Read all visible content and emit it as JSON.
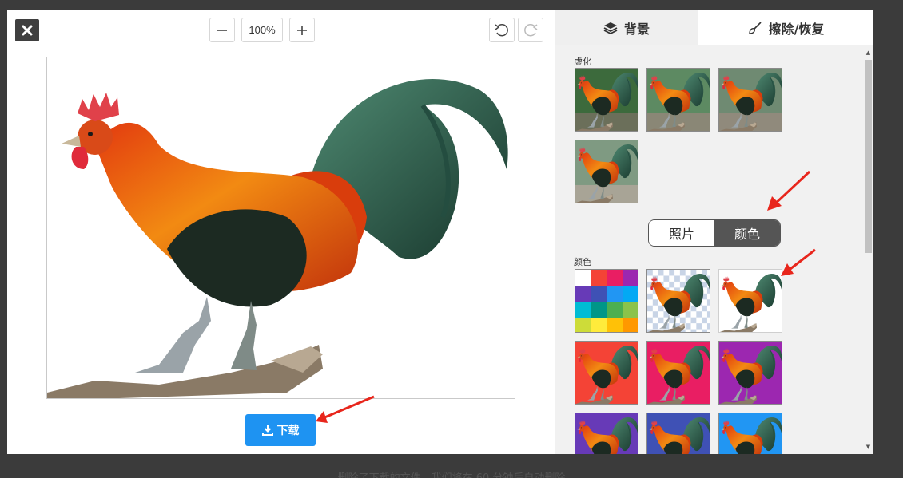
{
  "toolbar": {
    "zoom_level": "100%"
  },
  "download": {
    "label": "下载"
  },
  "tabs": {
    "background": "背景",
    "erase_restore": "擦除/恢复"
  },
  "blur_section": {
    "label": "虚化"
  },
  "toggle": {
    "photo": "照片",
    "color": "颜色"
  },
  "color_section": {
    "label": "颜色",
    "swatches": [
      "#f44336",
      "#e91e63",
      "#9c27b0",
      "#673ab7",
      "#3f51b5",
      "#2196f3"
    ]
  },
  "palette_colors": [
    "#ffffff",
    "#f44336",
    "#e91e63",
    "#9c27b0",
    "#673ab7",
    "#3f51b5",
    "#2196f3",
    "#03a9f4",
    "#00bcd4",
    "#009688",
    "#4caf50",
    "#8bc34a",
    "#cddc39",
    "#ffeb3b",
    "#ffc107",
    "#ff9800"
  ],
  "footer": {
    "caption": "删除了下载的文件，我们将在 60 分钟后自动删除"
  },
  "colors": {
    "accent": "#1e93f2",
    "arrow": "#e8261c"
  }
}
